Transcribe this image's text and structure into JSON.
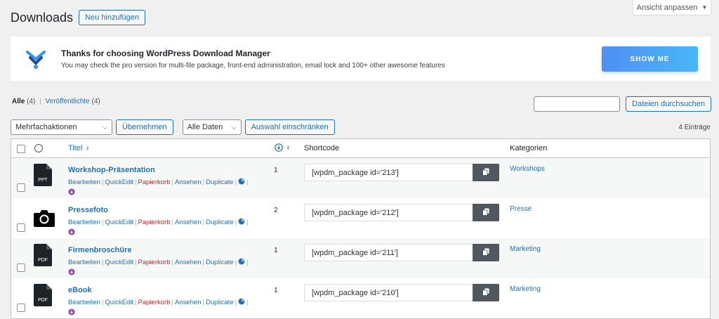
{
  "screen_options": {
    "label": "Ansicht anpassen"
  },
  "header": {
    "title": "Downloads",
    "add_new": "Neu hinzufügen"
  },
  "notice": {
    "title": "Thanks for choosing WordPress Download Manager",
    "text": "You may check the pro version for multi-file package, front-end administration, email lock and 100+ other awesome features",
    "button": "SHOW ME"
  },
  "views": {
    "all_label": "Alle",
    "all_count": "(4)",
    "published_label": "Veröffentlichte",
    "published_count": "(4)"
  },
  "search": {
    "placeholder": "",
    "button": "Dateien durchsuchen"
  },
  "tablenav": {
    "bulk_select": "Mehrfachaktionen",
    "apply": "Übernehmen",
    "date_select": "Alle Daten",
    "filter": "Auswahl einschränken",
    "items_count": "4 Einträge"
  },
  "columns": {
    "title": "Titel",
    "shortcode": "Shortcode",
    "categories": "Kategorien"
  },
  "row_actions": {
    "edit": "Bearbeiten",
    "quickedit": "QuickEdit",
    "trash": "Papierkorb",
    "view": "Ansehen",
    "duplicate": "Duplicate",
    "sep": "|"
  },
  "rows": [
    {
      "title": "Workshop-Präsentation",
      "icon": "ppt-file-icon",
      "icon_label": "PPT",
      "downloads": "1",
      "shortcode": "[wpdm_package id='213']",
      "category": "Workshops"
    },
    {
      "title": "Pressefoto",
      "icon": "camera-icon",
      "icon_label": "",
      "downloads": "2",
      "shortcode": "[wpdm_package id='212']",
      "category": "Presse"
    },
    {
      "title": "Firmenbroschüre",
      "icon": "pdf-file-icon",
      "icon_label": "PDF",
      "downloads": "1",
      "shortcode": "[wpdm_package id='211']",
      "category": "Marketing"
    },
    {
      "title": "eBook",
      "icon": "pdf-file-icon",
      "icon_label": "PDF",
      "downloads": "1",
      "shortcode": "[wpdm_package id='210']",
      "category": "Marketing"
    }
  ],
  "colors": {
    "accent": "#2271b1",
    "trash": "#b32d2e",
    "copy_button": "#50575e",
    "notice_button": "#4f8ff6"
  }
}
